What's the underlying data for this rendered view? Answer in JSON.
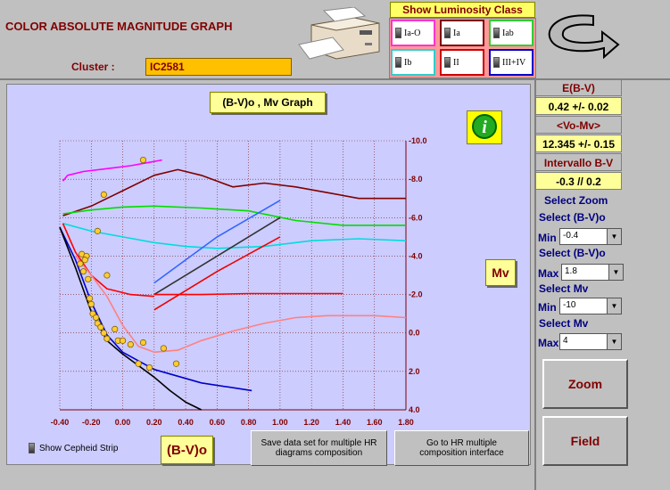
{
  "header": {
    "title": "COLOR ABSOLUTE MAGNITUDE GRAPH",
    "cluster_label": "Cluster :",
    "cluster_value": "IC2581"
  },
  "luminosity": {
    "title": "Show Luminosity Class",
    "classes": [
      {
        "label": "Ia-O",
        "color": "#ff33cc"
      },
      {
        "label": "Ia",
        "color": "#800000"
      },
      {
        "label": "Iab",
        "color": "#33cc33"
      },
      {
        "label": "Ib",
        "color": "#33cccc"
      },
      {
        "label": "II",
        "color": "#cc0000"
      },
      {
        "label": "III+IV",
        "color": "#0000cc"
      }
    ]
  },
  "plot": {
    "title": "(B-V)o , Mv Graph",
    "ylabel": "Mv",
    "xlabel": "(B-V)o",
    "show_cepheid": "Show Cepheid Strip",
    "save_button": "Save data set for multiple HR diagrams composition",
    "goto_button": "Go to HR multiple composition interface"
  },
  "right_panel": {
    "ebv_label": "E(B-V)",
    "ebv_value": "0.42 +/- 0.02",
    "vomv_label": "<Vo-Mv>",
    "vomv_value": "12.345 +/- 0.15",
    "interval_label": "Intervallo B-V",
    "interval_value": "-0.3 // 0.2",
    "select_zoom": "Select Zoom",
    "sel_bv_1": "Select (B-V)o",
    "min_label": "Min",
    "bv_min": "-0.4",
    "sel_bv_2": "Select (B-V)o",
    "max_label": "Max",
    "bv_max": "1.8",
    "sel_mv_1": "Select Mv",
    "mv_min_label": "Min",
    "mv_min": "-10",
    "sel_mv_2": "Select Mv",
    "mv_max_label": "Max",
    "mv_max": "4",
    "zoom_button": "Zoom",
    "field_button": "Field"
  },
  "chart_data": {
    "type": "scatter",
    "xlabel": "(B-V)o",
    "ylabel": "Mv",
    "xlim": [
      -0.4,
      1.8
    ],
    "ylim": [
      4.0,
      -10.0
    ],
    "x_ticks": [
      "-0.40",
      "-0.20",
      "0.00",
      "0.20",
      "0.40",
      "0.60",
      "0.80",
      "1.00",
      "1.20",
      "1.40",
      "1.60",
      "1.80"
    ],
    "y_ticks": [
      "-10.0",
      "-8.0",
      "-6.0",
      "-4.0",
      "-2.0",
      "0.0",
      "2.0",
      "4.0"
    ],
    "grid": true,
    "points": [
      {
        "x": 0.13,
        "y": -9.0
      },
      {
        "x": -0.12,
        "y": -7.2
      },
      {
        "x": -0.16,
        "y": -5.3
      },
      {
        "x": -0.26,
        "y": -4.1
      },
      {
        "x": -0.23,
        "y": -4.0
      },
      {
        "x": -0.24,
        "y": -3.8
      },
      {
        "x": -0.27,
        "y": -3.6
      },
      {
        "x": -0.25,
        "y": -3.2
      },
      {
        "x": -0.22,
        "y": -2.8
      },
      {
        "x": -0.1,
        "y": -3.0
      },
      {
        "x": -0.21,
        "y": -1.8
      },
      {
        "x": -0.2,
        "y": -1.5
      },
      {
        "x": -0.19,
        "y": -1.0
      },
      {
        "x": -0.17,
        "y": -0.8
      },
      {
        "x": -0.16,
        "y": -0.5
      },
      {
        "x": -0.14,
        "y": -0.3
      },
      {
        "x": -0.12,
        "y": 0.0
      },
      {
        "x": -0.1,
        "y": 0.3
      },
      {
        "x": -0.05,
        "y": -0.2
      },
      {
        "x": -0.03,
        "y": 0.4
      },
      {
        "x": 0.0,
        "y": 0.4
      },
      {
        "x": 0.05,
        "y": 0.6
      },
      {
        "x": 0.13,
        "y": 0.5
      },
      {
        "x": 0.26,
        "y": 0.8
      },
      {
        "x": 0.1,
        "y": 1.6
      },
      {
        "x": 0.17,
        "y": 1.8
      },
      {
        "x": 0.34,
        "y": 1.6
      }
    ],
    "series": [
      {
        "color": "#ff00ff",
        "x": [
          -0.38,
          -0.35,
          -0.25,
          -0.1,
          0.05,
          0.15,
          0.25
        ],
        "y": [
          -7.9,
          -8.2,
          -8.4,
          -8.55,
          -8.7,
          -8.85,
          -9.0
        ]
      },
      {
        "color": "#800000",
        "x": [
          -0.38,
          -0.2,
          0.0,
          0.2,
          0.35,
          0.5,
          0.7,
          0.9,
          1.1,
          1.3,
          1.5,
          1.7,
          1.8
        ],
        "y": [
          -6.1,
          -6.6,
          -7.4,
          -8.2,
          -8.5,
          -8.2,
          -7.6,
          -7.8,
          -7.6,
          -7.3,
          -7.0,
          -7.0,
          -7.0
        ]
      },
      {
        "color": "#00dd00",
        "x": [
          -0.38,
          -0.2,
          0.0,
          0.2,
          0.5,
          0.8,
          1.1,
          1.4,
          1.8
        ],
        "y": [
          -6.2,
          -6.4,
          -6.55,
          -6.6,
          -6.5,
          -6.35,
          -5.85,
          -5.6,
          -5.6
        ]
      },
      {
        "color": "#00dddd",
        "x": [
          -0.38,
          -0.2,
          0.0,
          0.2,
          0.4,
          0.6,
          0.9,
          1.2,
          1.5,
          1.8
        ],
        "y": [
          -5.7,
          -5.3,
          -5.0,
          -4.7,
          -4.5,
          -4.4,
          -4.5,
          -4.8,
          -4.9,
          -4.8
        ]
      },
      {
        "color": "#3366ff",
        "x": [
          0.2,
          0.6,
          1.0
        ],
        "y": [
          -2.6,
          -5.0,
          -6.9
        ]
      },
      {
        "color": "#333333",
        "x": [
          0.2,
          0.6,
          1.0
        ],
        "y": [
          -2.0,
          -4.0,
          -6.0
        ]
      },
      {
        "color": "#ee0000",
        "x": [
          0.2,
          0.6,
          1.0
        ],
        "y": [
          -1.2,
          -3.2,
          -5.0
        ]
      },
      {
        "color": "#ff0000",
        "x": [
          -0.38,
          -0.3,
          -0.2,
          -0.1,
          0.05,
          0.2
        ],
        "y": [
          -5.7,
          -4.2,
          -3.0,
          -2.3,
          -2.0,
          -1.9
        ]
      },
      {
        "color": "#ff0000",
        "x": [
          0.2,
          0.5,
          0.8,
          1.1,
          1.4
        ],
        "y": [
          -2.0,
          -2.0,
          -2.05,
          -2.05,
          -2.05
        ]
      },
      {
        "color": "#ff8080",
        "x": [
          -0.3,
          -0.2,
          -0.1,
          0.0,
          0.1,
          0.2,
          0.35,
          0.5,
          0.7,
          0.9,
          1.1,
          1.3,
          1.5,
          1.6,
          1.8
        ],
        "y": [
          -4.0,
          -3.0,
          -1.9,
          -0.4,
          0.7,
          1.0,
          0.9,
          0.4,
          -0.1,
          -0.5,
          -0.8,
          -0.9,
          -0.9,
          -0.9,
          -0.8
        ]
      },
      {
        "color": "#0000cc",
        "x": [
          -0.4,
          -0.3,
          -0.2,
          -0.1,
          0.0,
          0.2,
          0.5,
          0.82
        ],
        "y": [
          -5.5,
          -3.8,
          -1.6,
          0.1,
          1.0,
          1.9,
          2.6,
          3.0
        ]
      },
      {
        "color": "#000000",
        "x": [
          -0.4,
          -0.3,
          -0.2,
          -0.1,
          0.0,
          0.1,
          0.2,
          0.3,
          0.4,
          0.5
        ],
        "y": [
          -5.5,
          -3.4,
          -1.1,
          0.4,
          1.1,
          1.7,
          2.3,
          3.0,
          3.6,
          4.0
        ]
      }
    ]
  }
}
